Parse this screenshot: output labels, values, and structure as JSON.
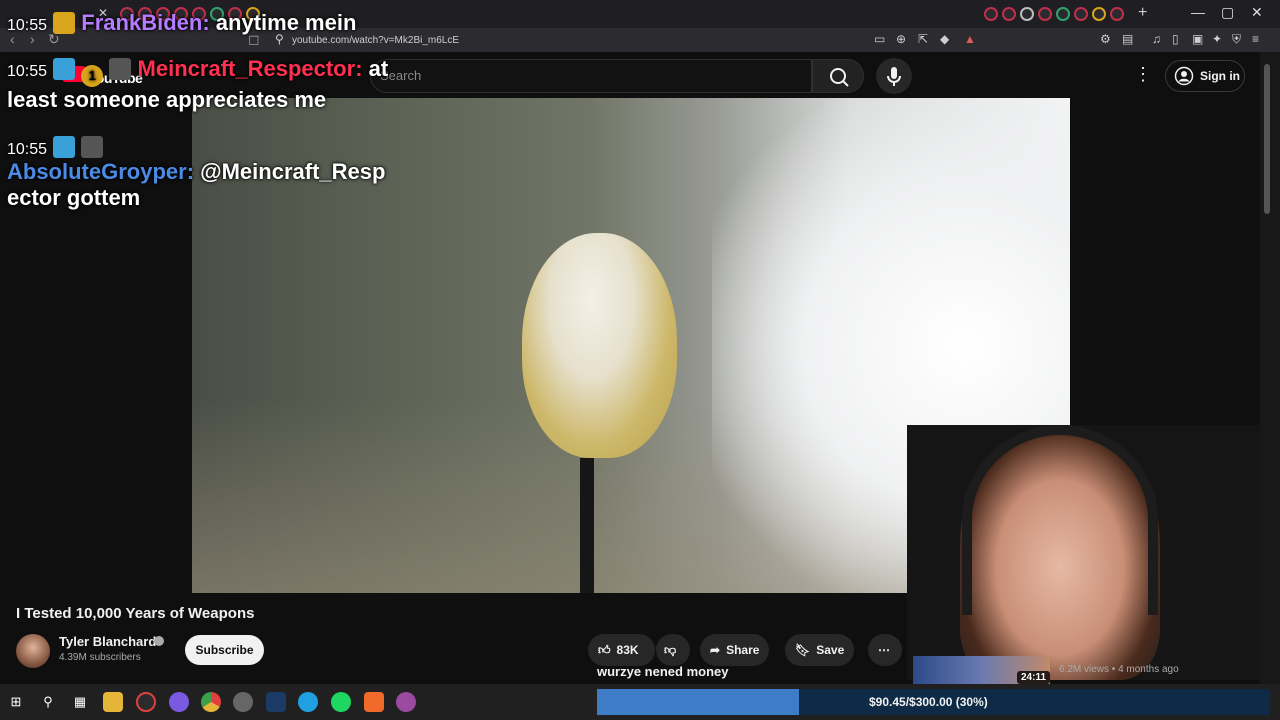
{
  "browser": {
    "url": "youtube.com/watch?v=Mk2Bi_m6LcE"
  },
  "youtube": {
    "logo_text": "YouTube",
    "search_placeholder": "Search",
    "signin_label": "Sign in"
  },
  "chat": [
    {
      "time": "10:55",
      "user": "FrankBiden",
      "user_color": "#b57cff",
      "message": "anytime mein"
    },
    {
      "time": "10:55",
      "user": "Meincraft_Respector",
      "user_color": "#ff3050",
      "message": "at least someone appreciates me"
    },
    {
      "time": "10:55",
      "user": "AbsoluteGroyper",
      "user_color": "#4b8be6",
      "message": "@Meincraft_Resp ector gottem"
    }
  ],
  "chat_badge_count": "1",
  "video": {
    "title": "I Tested 10,000 Years of Weapons",
    "channel": "Tyler Blanchard",
    "subscribers": "4.39M subscribers",
    "subscribe_label": "Subscribe",
    "likes": "83K",
    "share_label": "Share",
    "save_label": "Save"
  },
  "donation_message": "wurzye nened money",
  "recommended": {
    "duration": "24:11",
    "meta": "6.2M views • 4 months ago"
  },
  "goal": {
    "text": "$90.45/$300.00 (30%)",
    "progress": 0.3
  },
  "colors": {
    "youtube_red": "#ff0033",
    "goal_fill": "#3f7cc8",
    "goal_bg": "#0f2a46"
  }
}
